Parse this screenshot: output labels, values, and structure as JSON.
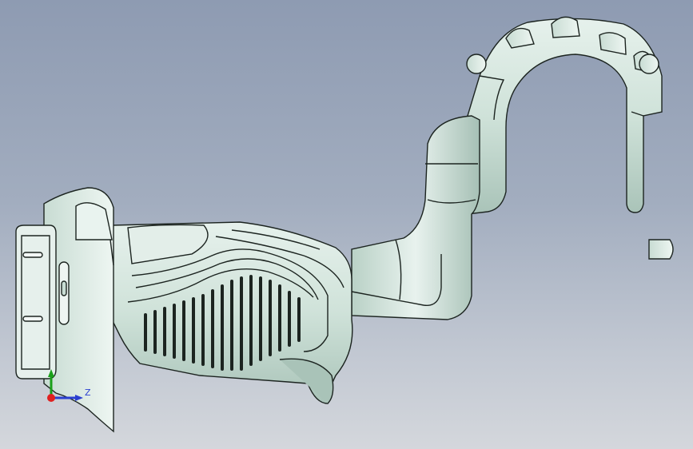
{
  "view": {
    "axis_z_label": "Z",
    "colors": {
      "background_top": "#8e9bb2",
      "background_bottom": "#d4d7dc",
      "part_fill": "#d8e8e0",
      "part_shade": "#9fb8ad",
      "edge": "#1c2420",
      "axis_x": "#e02020",
      "axis_y": "#1aa01a",
      "axis_z": "#2a3fd0"
    }
  },
  "model": {
    "description_icon": "3d-grip-part-icon"
  }
}
